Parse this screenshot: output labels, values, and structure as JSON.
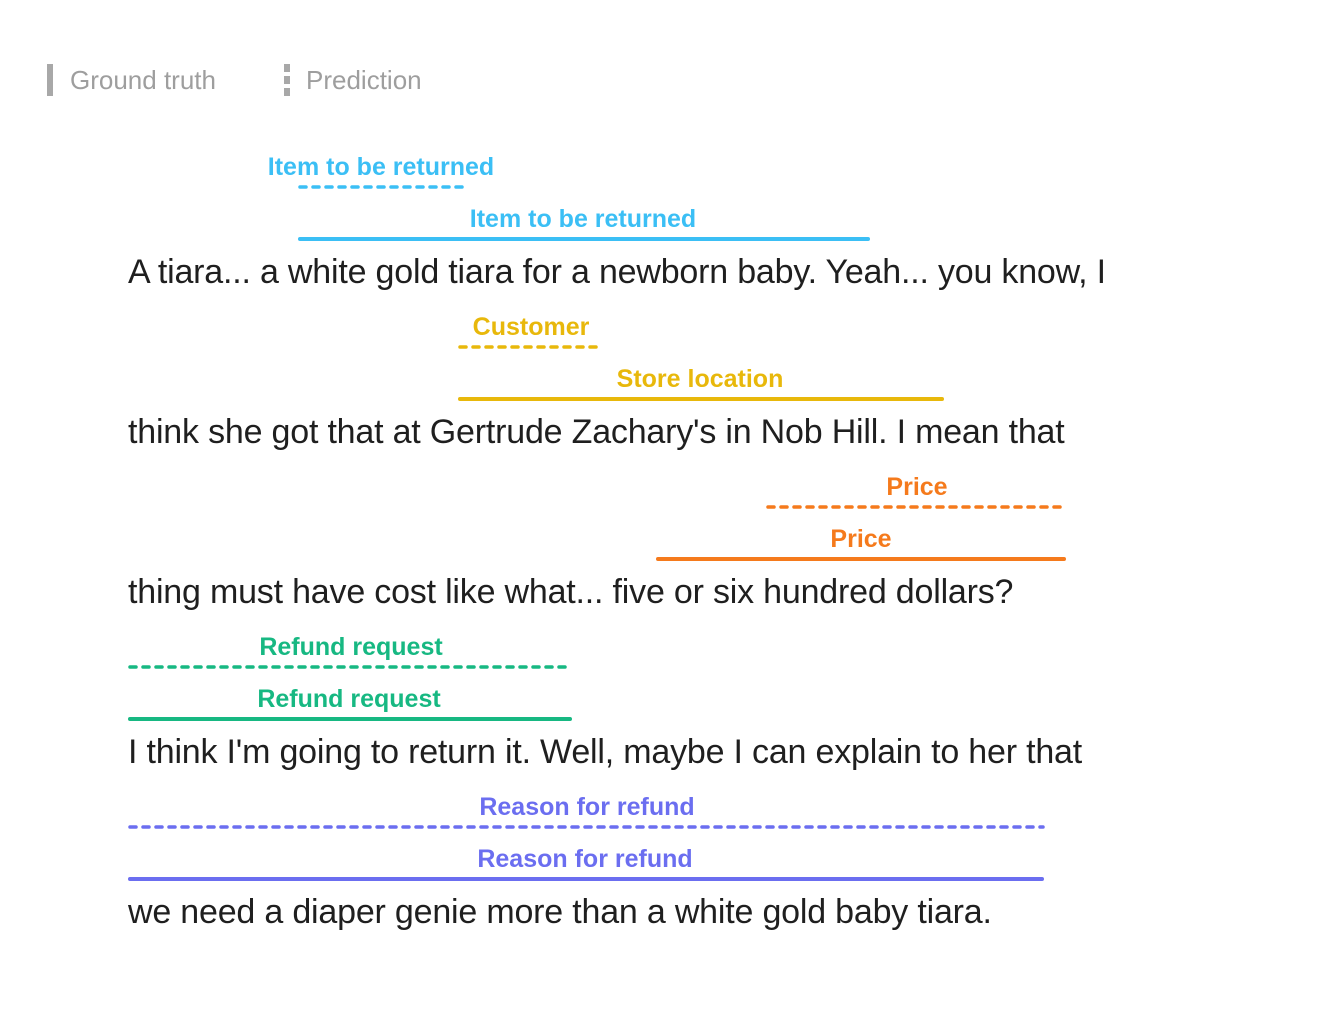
{
  "legend": {
    "ground_truth_label": "Ground truth",
    "prediction_label": "Prediction",
    "marker_color": "#a8a8a8"
  },
  "colors": {
    "item": "#3bbff5",
    "customer": "#e8b80b",
    "price": "#f57a1c",
    "refund": "#17b882",
    "reason": "#6b6ef0"
  },
  "lines": [
    {
      "text": "A tiara... a white gold tiara for a newborn baby. Yeah... you know, I",
      "prediction": {
        "label": "Item to be returned",
        "span_text": "a white",
        "color_key": "item"
      },
      "ground_truth": {
        "label": "Item to be returned",
        "span_text": "a white gold tiara for a newborn baby",
        "color_key": "item"
      }
    },
    {
      "text": "think she got that at Gertrude Zachary's in Nob Hill. I mean that",
      "prediction": {
        "label": "Customer",
        "span_text": "Gertrude",
        "color_key": "customer"
      },
      "ground_truth": {
        "label": "Store location",
        "span_text": "Gertrude Zachary's in Nob Hill",
        "color_key": "customer"
      }
    },
    {
      "text": "thing must have cost like what... five or six hundred dollars?",
      "prediction": {
        "label": "Price",
        "span_text": "six hundred dollars",
        "color_key": "price"
      },
      "ground_truth": {
        "label": "Price",
        "span_text": "five or six hundred dollars",
        "color_key": "price"
      }
    },
    {
      "text": "I think I'm going to return it. Well, maybe I can explain to her that",
      "prediction": {
        "label": "Refund request",
        "span_text": "I think I'm going to return it.",
        "color_key": "refund"
      },
      "ground_truth": {
        "label": "Refund request",
        "span_text": "I think I'm going to return it.",
        "color_key": "refund"
      }
    },
    {
      "text": "we need a diaper genie more than a white gold baby tiara.",
      "prediction": {
        "label": "Reason for refund",
        "span_text": "we need a diaper genie more than a white gold baby tiara",
        "color_key": "reason"
      },
      "ground_truth": {
        "label": "Reason for refund",
        "span_text": "we need a diaper genie more than a white gold baby tiara",
        "color_key": "reason"
      }
    }
  ]
}
